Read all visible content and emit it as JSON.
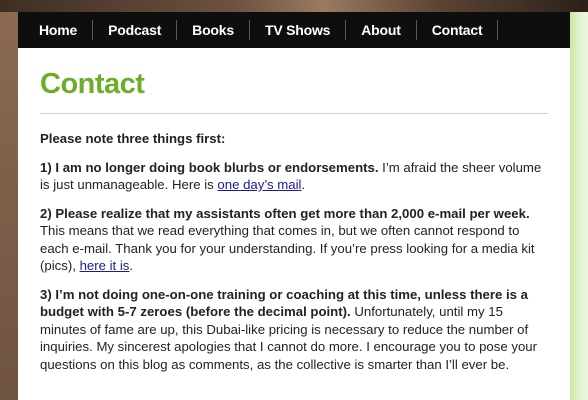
{
  "nav": {
    "items": [
      "Home",
      "Podcast",
      "Books",
      "TV Shows",
      "About",
      "Contact"
    ]
  },
  "page": {
    "title": "Contact",
    "note": "Please note three things first:",
    "p1": {
      "bold": "1) I am no longer doing book blurbs or endorsements.",
      "text": " I’m afraid the sheer volume is just unmanageable. Here is ",
      "link": "one day’s mail",
      "end": "."
    },
    "p2": {
      "bold": "2) Please realize that my assistants often get more than 2,000 e-mail per week.",
      "text": " This means that we read everything that comes in, but we often cannot respond to each e-mail. Thank you for your understanding. If you’re press looking for a media kit (pics), ",
      "link": "here it is",
      "end": "."
    },
    "p3": {
      "bold": "3) I’m not doing one-on-one training or coaching at this time, unless there is a budget with 5-7 zeroes (before the decimal point).",
      "text": " Unfortunately, until my 15 minutes of fame are up, this Dubai-like pricing is necessary to reduce the number of inquiries. My sincerest apologies that I cannot do more. I encourage you to pose your questions on this blog as comments, as the collective is smarter than I’ll ever be."
    }
  },
  "colors": {
    "title": "#6cae2a",
    "nav_bg": "#0e0e0e",
    "link": "#1a1a9c"
  }
}
